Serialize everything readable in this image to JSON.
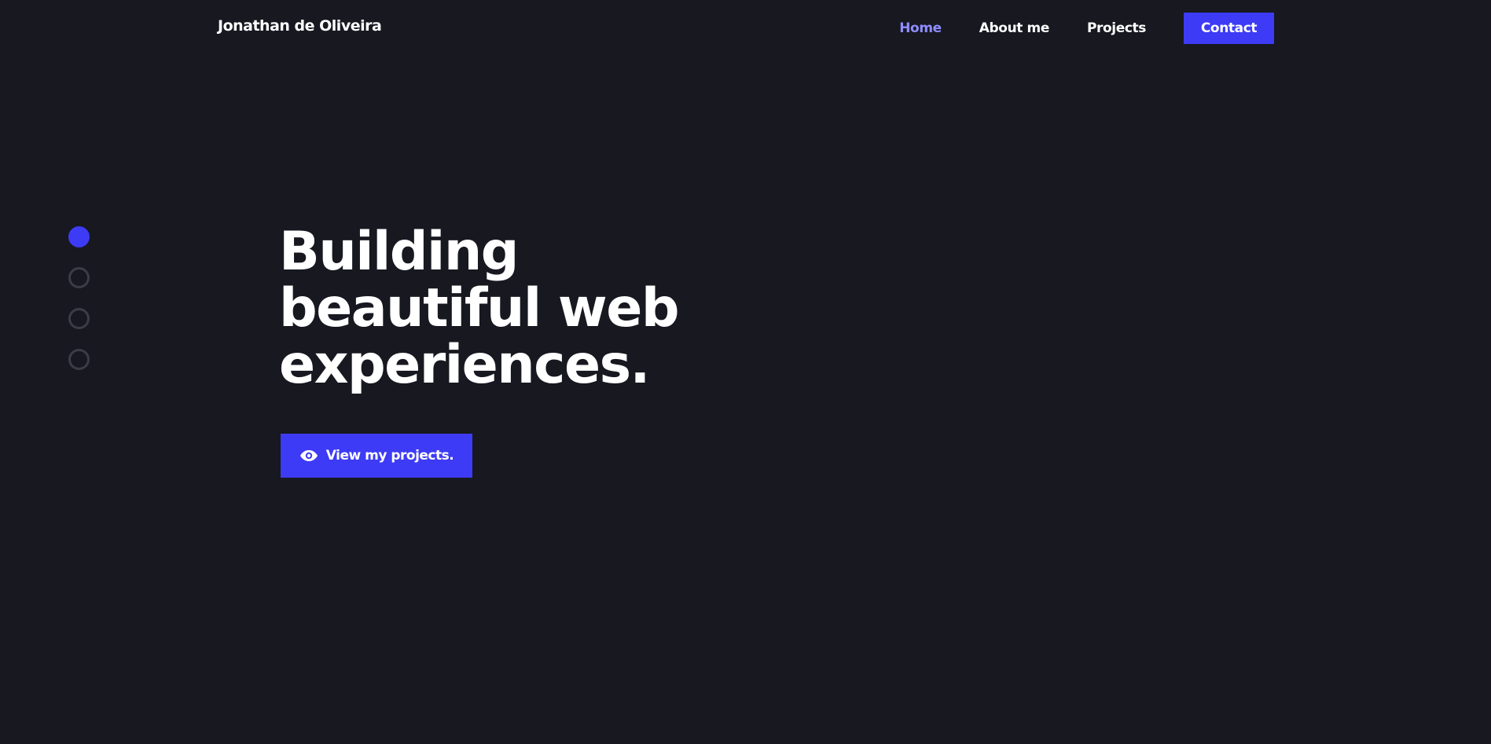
{
  "header": {
    "brand": "Jonathan de Oliveira",
    "nav": {
      "home": "Home",
      "about": "About me",
      "projects": "Projects",
      "contact": "Contact"
    },
    "active_item": "Home"
  },
  "section_nav": {
    "count": 4,
    "active_index": 0
  },
  "hero": {
    "title_lines": [
      "Building",
      "beautiful web",
      "experiences."
    ],
    "cta": {
      "label": "View my projects.",
      "icon": "eye-icon"
    }
  },
  "colors": {
    "background": "#171820",
    "accent": "#3d3bf5",
    "active_link": "#8f8dff",
    "text": "#ffffff",
    "inactive_dot": "#3b3c46"
  }
}
